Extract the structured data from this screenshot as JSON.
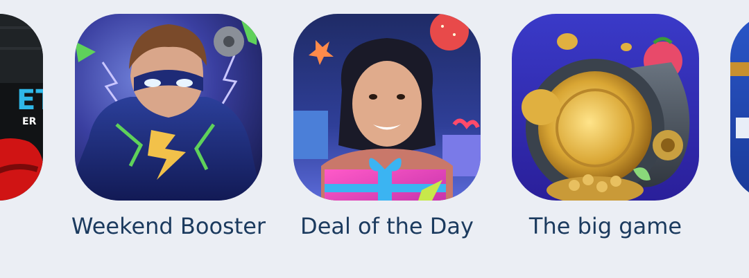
{
  "promos": [
    {
      "title": "Weekend Booster"
    },
    {
      "title": "Deal of the Day"
    },
    {
      "title": "The big game"
    }
  ],
  "partial_left": {
    "text_big": "ET",
    "text_small": "ER"
  }
}
